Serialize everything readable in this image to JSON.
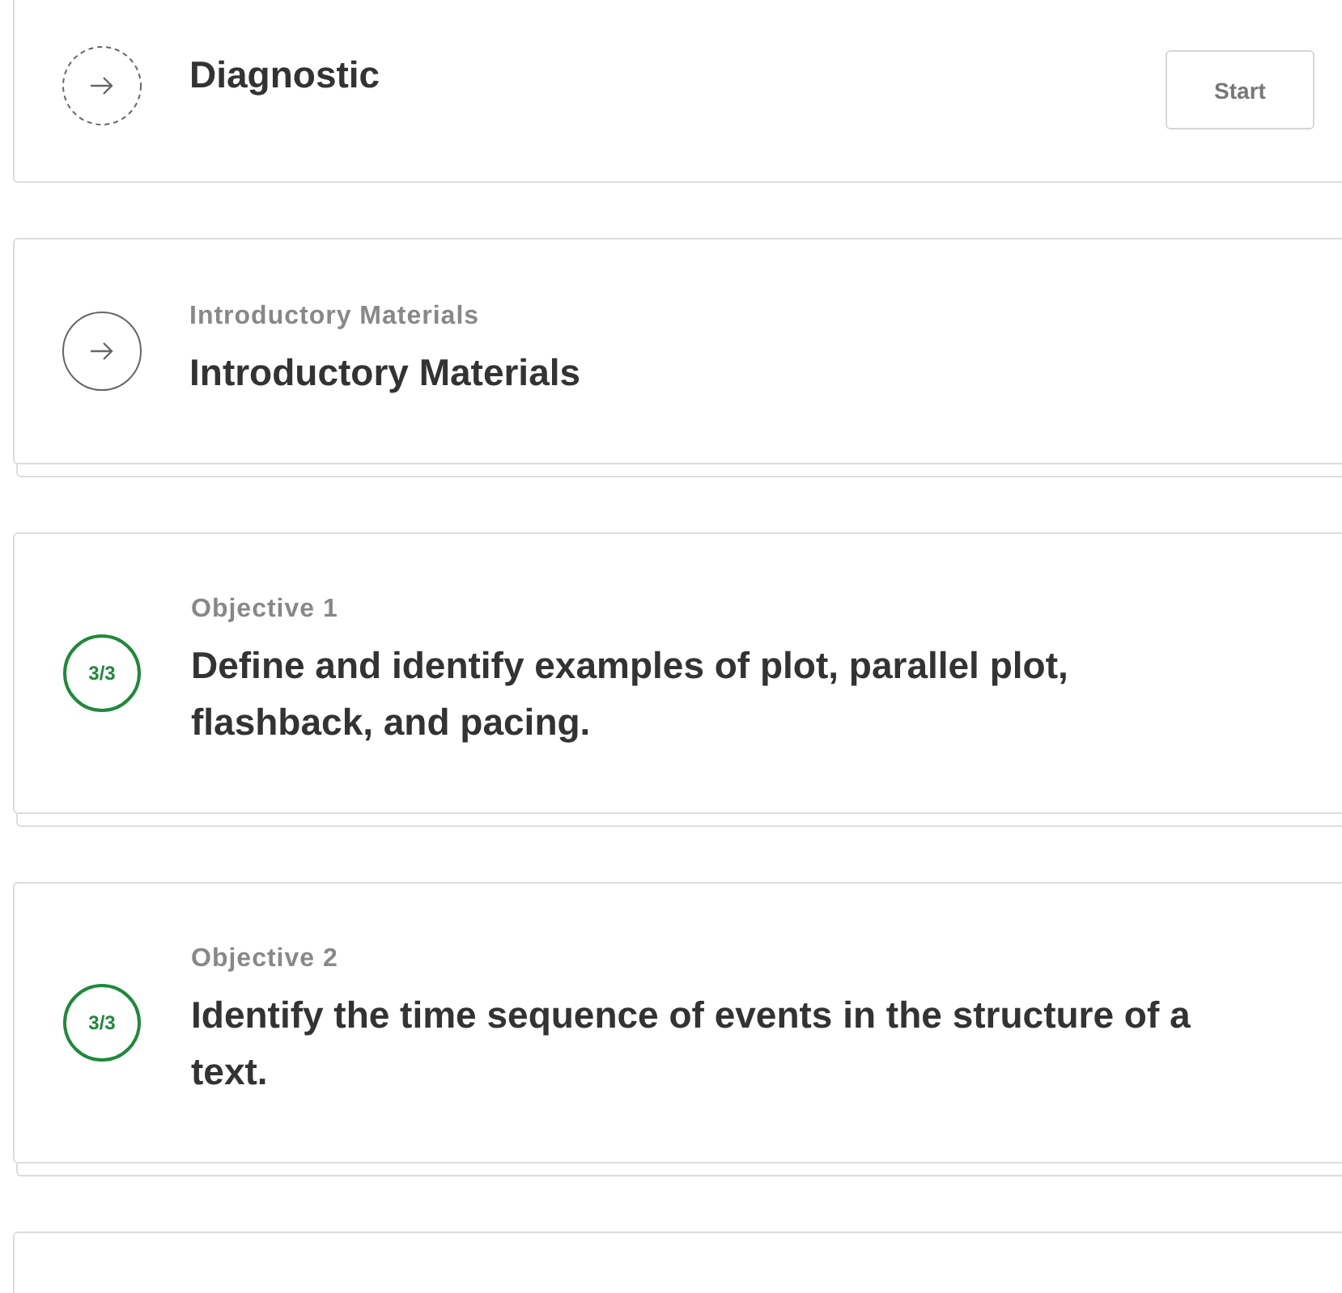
{
  "items": [
    {
      "kind": "diagnostic",
      "title": "Diagnostic",
      "button": "Start"
    },
    {
      "kind": "materials",
      "label": "Introductory Materials",
      "title": "Introductory Materials"
    },
    {
      "kind": "objective",
      "label": "Objective 1",
      "score": "3/3",
      "title": "Define and identify examples of plot, parallel plot, flashback, and pacing."
    },
    {
      "kind": "objective",
      "label": "Objective 2",
      "score": "3/3",
      "title": "Identify the time sequence of events in the structure of a text."
    },
    {
      "kind": "partial"
    }
  ]
}
